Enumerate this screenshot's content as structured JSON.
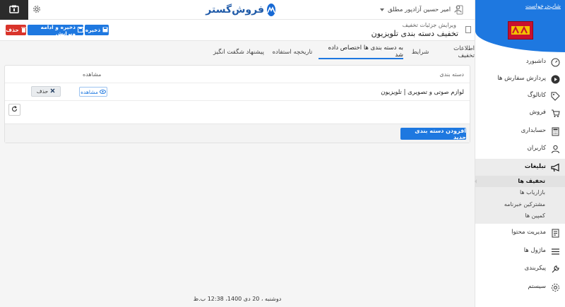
{
  "topbar": {
    "brand": "فروش‌گستر",
    "user_name": "امیر حسین آزادپور مطلق"
  },
  "sidebar": {
    "title": "شاپ‌درخواست",
    "items": [
      {
        "label": "داشبورد",
        "icon": "dashboard-icon"
      },
      {
        "label": "پردازش سفارش ها",
        "icon": "play-circle-icon"
      },
      {
        "label": "کاتالوگ",
        "icon": "tag-icon"
      },
      {
        "label": "فروش",
        "icon": "cart-icon"
      },
      {
        "label": "حسابداری",
        "icon": "calculator-icon"
      },
      {
        "label": "کاربران",
        "icon": "user-icon"
      },
      {
        "label": "تبلیغات",
        "icon": "megaphone-icon"
      },
      {
        "label": "مدیریت محتوا",
        "icon": "content-icon"
      },
      {
        "label": "ماژول ها",
        "icon": "list-icon"
      },
      {
        "label": "پیکربندی",
        "icon": "wrench-icon"
      },
      {
        "label": "سیستم",
        "icon": "gear-icon"
      }
    ],
    "sub_items": [
      {
        "label": "تخفیف ها",
        "active": true
      },
      {
        "label": "بازاریاب ها",
        "active": false
      },
      {
        "label": "مشترکین خبرنامه",
        "active": false
      },
      {
        "label": "کمپین ها",
        "active": false
      }
    ]
  },
  "header": {
    "breadcrumb": "ویرایش جزئیات تخفیف",
    "title": "تخفیف دسته بندی تلویزیون",
    "buttons": {
      "save": "ذخیره",
      "save_continue": "ذخیره و ادامه ویرایش",
      "delete": "حذف"
    }
  },
  "tabs": [
    {
      "label": "اطلاعات تخفیف",
      "active": false
    },
    {
      "label": "شرایط",
      "active": false
    },
    {
      "label": "به دسته بندی ها اختصاص داده شد",
      "active": true
    },
    {
      "label": "تاریخچه استفاده",
      "active": false
    },
    {
      "label": "پیشنهاد شگفت انگیز",
      "active": false
    }
  ],
  "table": {
    "columns": {
      "category": "دسته بندی",
      "view": "مشاهده"
    },
    "rows": [
      {
        "category": "لوازم صوتی و تصویری | تلویزیون",
        "view_label": "مشاهده",
        "delete_label": "حذف"
      }
    ],
    "add_button": "افزودن دسته بندی جدید"
  },
  "footer": {
    "datetime": "دوشنبه ، 20 دی 1400، 12:38 ب.ظ"
  },
  "colors": {
    "primary": "#1e78e0",
    "danger": "#d9342b"
  }
}
